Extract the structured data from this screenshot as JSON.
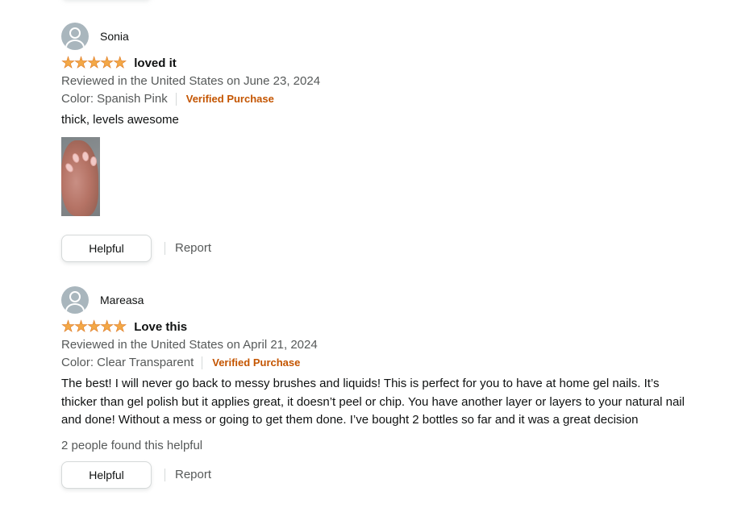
{
  "reviews": [
    {
      "reviewer": "Sonia",
      "rating": 5,
      "title": "loved it",
      "date_line": "Reviewed in the United States on June 23, 2024",
      "variant": "Color: Spanish Pink",
      "badge": "Verified Purchase",
      "body": "thick, levels awesome",
      "helpful_label": "Helpful",
      "report_label": "Report"
    },
    {
      "reviewer": "Mareasa",
      "rating": 5,
      "title": "Love this",
      "date_line": "Reviewed in the United States on April 21, 2024",
      "variant": "Color: Clear Transparent",
      "badge": "Verified Purchase",
      "body": "The best! I will never go back to messy brushes and liquids! This is perfect for you to have at home gel nails. It’s thicker than gel polish but it applies great, it doesn’t peel or chip. You have another layer or layers to your natural nail and done! Without a mess or going to get them done. I’ve bought 2 bottles so far and it was a great decision",
      "helpful_count_text": "2 people found this helpful",
      "helpful_label": "Helpful",
      "report_label": "Report"
    }
  ],
  "icons": {
    "avatar": "user-avatar-icon",
    "star": "star-icon"
  },
  "colors": {
    "star": "#f3a847",
    "verified": "#c45500",
    "secondary_text": "#565959"
  }
}
